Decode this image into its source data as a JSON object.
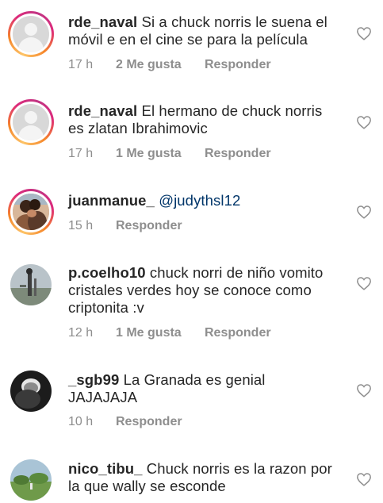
{
  "comments": [
    {
      "username": "rde_naval",
      "text": "Si a chuck norris le suena el",
      "text2": "móvil e en el cine se para la película",
      "time": "17 h",
      "likes": "2 Me gusta",
      "reply": "Responder",
      "avatar": "default-avatar-icon",
      "story_ring": true
    },
    {
      "username": "rde_naval",
      "text": "El hermano de chuck norris",
      "text2": "es zlatan Ibrahimovic",
      "time": "17 h",
      "likes": "1 Me gusta",
      "reply": "Responder",
      "avatar": "default-avatar-icon",
      "story_ring": true
    },
    {
      "username": "juanmanue_",
      "mention": "@judythsl12",
      "time": "15 h",
      "reply": "Responder",
      "avatar": "couple-photo-avatar",
      "story_ring": true
    },
    {
      "username": "p.coelho10",
      "text": "chuck norri de niño vomito",
      "text2": "cristales verdes hoy se conoce como",
      "text3": "criptonita :v",
      "time": "12 h",
      "likes": "1 Me gusta",
      "reply": "Responder",
      "avatar": "outdoor-photo-avatar",
      "story_ring": false
    },
    {
      "username": "_sgb99",
      "text": "La Granada es genial",
      "text2": "JAJAJAJA",
      "time": "10 h",
      "reply": "Responder",
      "avatar": "dark-photo-avatar",
      "story_ring": false
    },
    {
      "username": "nico_tibu_",
      "text": "Chuck norris es la razon por",
      "text2": "la que wally se esconde",
      "avatar": "landscape-photo-avatar",
      "story_ring": false
    }
  ],
  "colors": {
    "text": "#262626",
    "meta": "#8e8e8e",
    "mention": "#003569",
    "heart_outline": "#8e8e8e"
  },
  "icons": {
    "like": "heart-outline-icon"
  }
}
